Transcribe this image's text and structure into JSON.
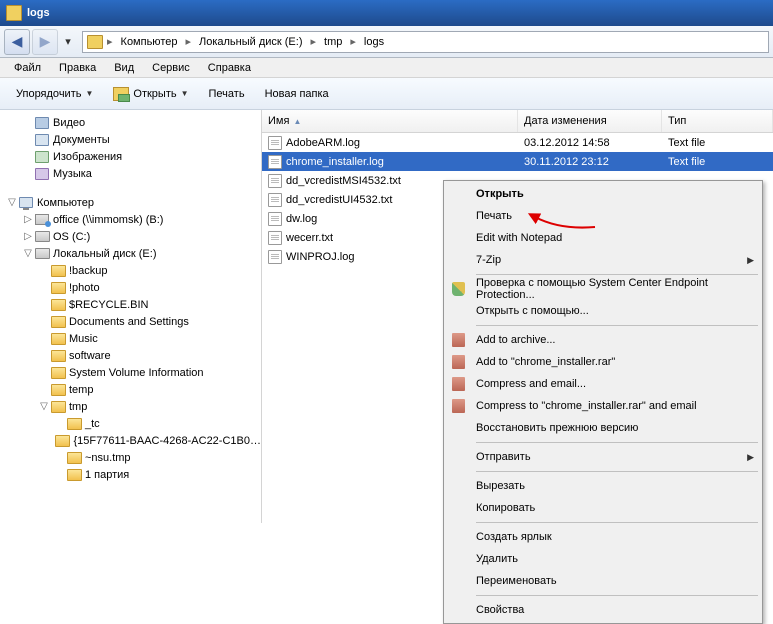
{
  "window_title": "logs",
  "breadcrumb": [
    "Компьютер",
    "Локальный диск (E:)",
    "tmp",
    "logs"
  ],
  "menu": {
    "file": "Файл",
    "edit": "Правка",
    "view": "Вид",
    "tools": "Сервис",
    "help": "Справка"
  },
  "toolbar": {
    "organize": "Упорядочить",
    "open": "Открыть",
    "print": "Печать",
    "newfolder": "Новая папка"
  },
  "columns": {
    "name": "Имя",
    "date": "Дата изменения",
    "type": "Тип"
  },
  "tree_libs": [
    {
      "label": "Видео",
      "ico": "video"
    },
    {
      "label": "Документы",
      "ico": "doc"
    },
    {
      "label": "Изображения",
      "ico": "img"
    },
    {
      "label": "Музыка",
      "ico": "music"
    }
  ],
  "tree_computer": "Компьютер",
  "tree_drives": [
    {
      "label": "office (\\\\immomsk) (B:)",
      "ico": "net",
      "sub": []
    },
    {
      "label": "OS (C:)",
      "ico": "drive",
      "sub": []
    },
    {
      "label": "Локальный диск (E:)",
      "ico": "drive",
      "sub": [
        "!backup",
        "!photo",
        "$RECYCLE.BIN",
        "Documents and Settings",
        "Music",
        "software",
        "System Volume Information",
        "temp",
        {
          "label": "tmp",
          "sub": [
            "_tc",
            "{15F77611-BAAC-4268-AC22-C1B0…",
            "~nsu.tmp",
            "1 партия"
          ]
        }
      ]
    }
  ],
  "files": [
    {
      "name": "AdobeARM.log",
      "date": "03.12.2012 14:58",
      "type": "Text file",
      "sel": false
    },
    {
      "name": "chrome_installer.log",
      "date": "30.11.2012 23:12",
      "type": "Text file",
      "sel": true
    },
    {
      "name": "dd_vcredistMSI4532.txt",
      "date": "",
      "type": "",
      "sel": false
    },
    {
      "name": "dd_vcredistUI4532.txt",
      "date": "",
      "type": "",
      "sel": false
    },
    {
      "name": "dw.log",
      "date": "",
      "type": "",
      "sel": false
    },
    {
      "name": "wecerr.txt",
      "date": "",
      "type": "",
      "sel": false
    },
    {
      "name": "WINPROJ.log",
      "date": "",
      "type": "",
      "sel": false
    }
  ],
  "context_menu": [
    {
      "label": "Открыть",
      "bold": true
    },
    {
      "label": "Печать"
    },
    {
      "label": "Edit with Notepad"
    },
    {
      "label": "7-Zip",
      "submenu": true
    },
    {
      "sep": true
    },
    {
      "label": "Проверка с помощью System Center Endpoint Protection...",
      "icon": "shield"
    },
    {
      "label": "Открыть с помощью..."
    },
    {
      "sep": true
    },
    {
      "label": "Add to archive...",
      "icon": "book"
    },
    {
      "label": "Add to \"chrome_installer.rar\"",
      "icon": "book"
    },
    {
      "label": "Compress and email...",
      "icon": "book"
    },
    {
      "label": "Compress to \"chrome_installer.rar\" and email",
      "icon": "book"
    },
    {
      "label": "Восстановить прежнюю версию"
    },
    {
      "sep": true
    },
    {
      "label": "Отправить",
      "submenu": true
    },
    {
      "sep": true
    },
    {
      "label": "Вырезать"
    },
    {
      "label": "Копировать"
    },
    {
      "sep": true
    },
    {
      "label": "Создать ярлык"
    },
    {
      "label": "Удалить"
    },
    {
      "label": "Переименовать"
    },
    {
      "sep": true
    },
    {
      "label": "Свойства"
    }
  ]
}
